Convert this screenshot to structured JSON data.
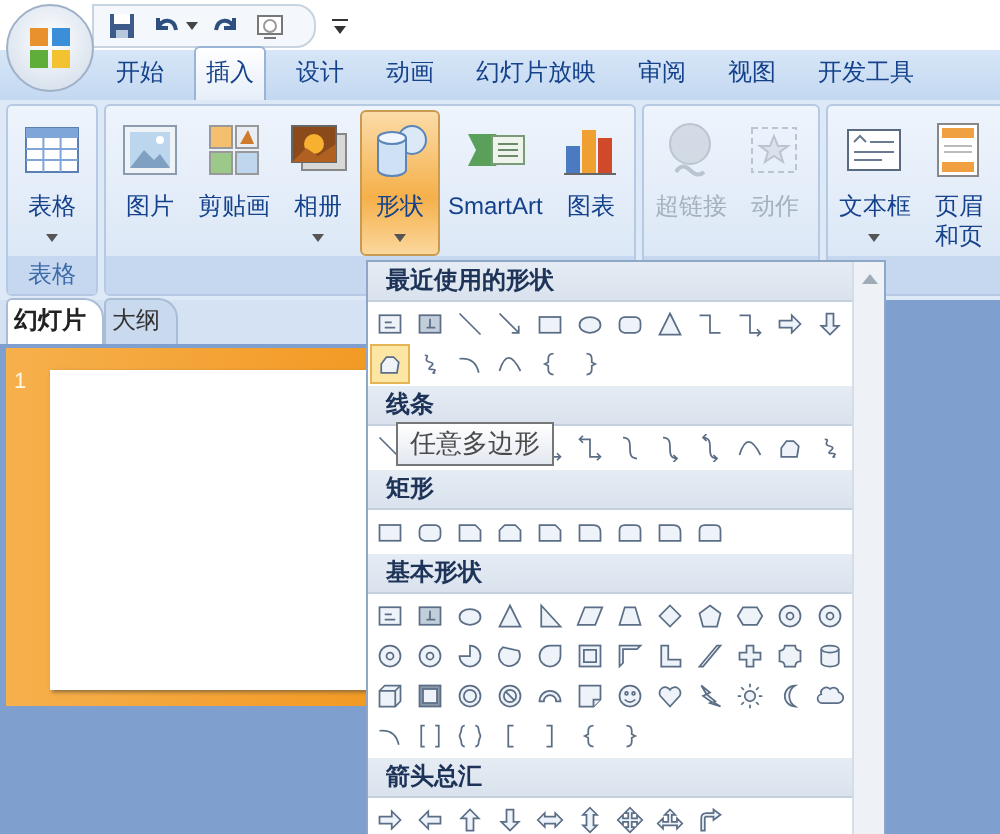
{
  "tabs": [
    {
      "label": "开始",
      "selected": false
    },
    {
      "label": "插入",
      "selected": true
    },
    {
      "label": "设计",
      "selected": false
    },
    {
      "label": "动画",
      "selected": false
    },
    {
      "label": "幻灯片放映",
      "selected": false
    },
    {
      "label": "审阅",
      "selected": false
    },
    {
      "label": "视图",
      "selected": false
    },
    {
      "label": "开发工具",
      "selected": false
    }
  ],
  "ribbon": {
    "groups": [
      {
        "label": "表格",
        "buttons": [
          {
            "lines": [
              "表格"
            ],
            "dropdown": true,
            "selected": false,
            "disabled": false
          }
        ]
      },
      {
        "buttons": [
          {
            "lines": [
              "图片"
            ],
            "dropdown": false,
            "selected": false,
            "disabled": false
          },
          {
            "lines": [
              "剪贴画"
            ],
            "dropdown": false,
            "selected": false,
            "disabled": false
          },
          {
            "lines": [
              "相册"
            ],
            "dropdown": true,
            "selected": false,
            "disabled": false
          },
          {
            "lines": [
              "形状"
            ],
            "dropdown": true,
            "selected": true,
            "disabled": false
          },
          {
            "lines": [
              "SmartArt"
            ],
            "dropdown": false,
            "selected": false,
            "disabled": false
          },
          {
            "lines": [
              "图表"
            ],
            "dropdown": false,
            "selected": false,
            "disabled": false
          }
        ]
      },
      {
        "buttons": [
          {
            "lines": [
              "超链接"
            ],
            "dropdown": false,
            "selected": false,
            "disabled": true
          },
          {
            "lines": [
              "动作"
            ],
            "dropdown": false,
            "selected": false,
            "disabled": true
          }
        ]
      },
      {
        "buttons": [
          {
            "lines": [
              "文本框"
            ],
            "dropdown": true,
            "selected": false,
            "disabled": false
          },
          {
            "lines": [
              "页眉",
              "和页"
            ],
            "dropdown": false,
            "selected": false,
            "disabled": false
          }
        ]
      }
    ]
  },
  "slide_panel": {
    "tabs": [
      {
        "label": "幻灯片",
        "selected": true
      },
      {
        "label": "大纲",
        "selected": false
      }
    ],
    "slides": [
      {
        "number": "1",
        "selected": true
      }
    ]
  },
  "shapes_menu": {
    "sections": [
      {
        "title": "最近使用的形状",
        "shapes": [
          {
            "selected": false
          },
          {
            "selected": false
          },
          {
            "selected": false
          },
          {
            "selected": false
          },
          {
            "selected": false
          },
          {
            "selected": false
          },
          {
            "selected": false
          },
          {
            "selected": false
          },
          {
            "selected": false
          },
          {
            "selected": false
          },
          {
            "selected": false
          },
          {
            "selected": false
          },
          {
            "selected": true
          },
          {
            "selected": false
          },
          {
            "selected": false
          },
          {
            "selected": false
          },
          {
            "selected": false
          },
          {
            "selected": false
          }
        ]
      },
      {
        "title": "线条"
      },
      {
        "title": "矩形"
      },
      {
        "title": "基本形状"
      },
      {
        "title": "箭头总汇"
      }
    ],
    "tooltip": "任意多边形"
  }
}
